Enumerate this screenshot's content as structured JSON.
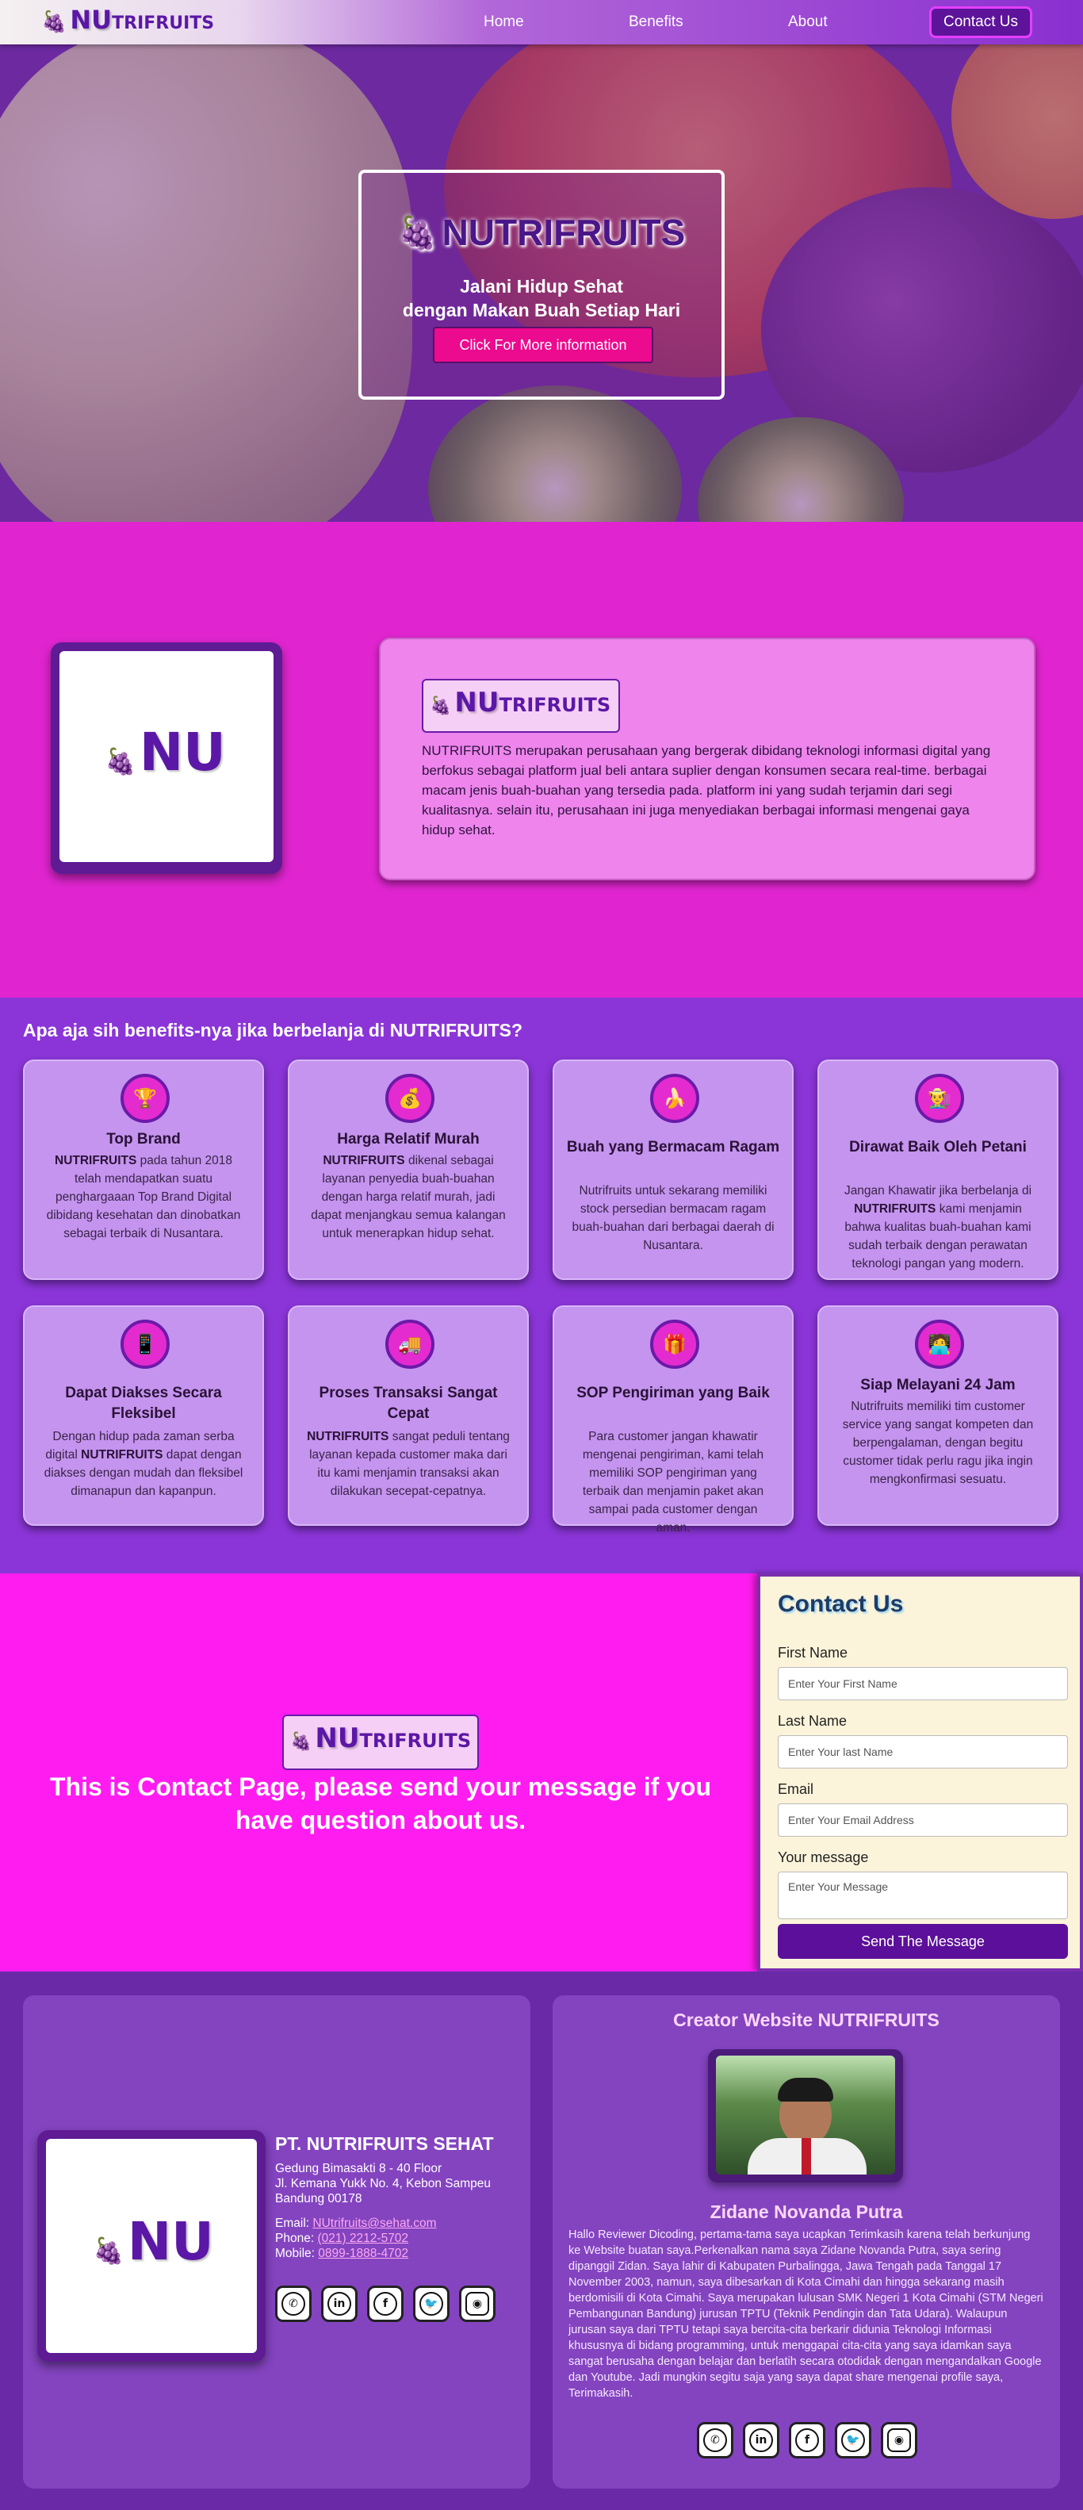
{
  "nav": {
    "logo_nu": "NU",
    "logo_rest": "TRIFRUITS",
    "links": [
      "Home",
      "Benefits",
      "About"
    ],
    "contact": "Contact Us"
  },
  "hero": {
    "title": "NUTRIFRUITS",
    "subtitle_line1": "Jalani Hidup Sehat",
    "subtitle_line2": "dengan Makan Buah Setiap Hari",
    "button": "Click For More information"
  },
  "about": {
    "logo_nu": "NU",
    "badge_nu": "NU",
    "badge_rest": "TRIFRUITS",
    "text": "NUTRIFRUITS merupakan perusahaan yang bergerak dibidang teknologi informasi digital yang berfokus sebagai platform jual beli antara suplier dengan konsumen secara real-time. berbagai macam jenis buah-buahan yang tersedia pada. platform ini yang sudah terjamin dari segi kualitasnya. selain itu, perusahaan ini juga menyediakan berbagai informasi mengenai gaya hidup sehat."
  },
  "benefits": {
    "heading": "Apa aja sih benefits-nya jika berbelanja di NUTRIFRUITS?",
    "cards": [
      {
        "icon": "trophy-icon",
        "glyph": "🏆",
        "title": "Top Brand",
        "bold": "NUTRIFRUITS",
        "desc": " pada tahun 2018 telah mendapatkan suatu penghargaaan Top Brand Digital dibidang kesehatan dan dinobatkan sebagai terbaik di Nusantara.",
        "tail": ""
      },
      {
        "icon": "money-bag-icon",
        "glyph": "💰",
        "title": "Harga Relatif Murah",
        "bold": "NUTRIFRUITS",
        "desc": " dikenal sebagai layanan penyedia buah-buahan dengan harga relatif murah, jadi dapat menjangkau semua kalangan untuk menerapkan hidup sehat.",
        "tail": ""
      },
      {
        "icon": "banana-icon",
        "glyph": "🍌",
        "title": "Buah yang Bermacam Ragam",
        "bold": "",
        "desc": "Nutrifruits untuk sekarang memiliki stock persedian bermacam ragam buah-buahan dari berbagai daerah di Nusantara.",
        "tail": ""
      },
      {
        "icon": "farmer-icon",
        "glyph": "👨‍🌾",
        "title": "Dirawat Baik Oleh Petani",
        "pre": "Jangan Khawatir jika berbelanja di ",
        "bold": "NUTRIFRUITS",
        "desc": " kami menjamin bahwa kualitas buah-buahan kami sudah terbaik dengan perawatan teknologi pangan yang modern.",
        "tail": ""
      },
      {
        "icon": "mobile-phone-icon",
        "glyph": "📱",
        "title": "Dapat Diakses Secara Fleksibel",
        "pre": "Dengan hidup pada zaman serba digital ",
        "bold": "NUTRIFRUITS",
        "desc": " dapat dengan diakses dengan mudah dan fleksibel dimanapun dan kapanpun.",
        "tail": ""
      },
      {
        "icon": "delivery-truck-icon",
        "glyph": "🚚",
        "title": "Proses Transaksi Sangat Cepat",
        "bold": "NUTRIFRUITS",
        "desc": " sangat peduli tentang layanan kepada customer maka dari itu kami menjamin transaksi akan dilakukan secepat-cepatnya.",
        "tail": ""
      },
      {
        "icon": "gift-icon",
        "glyph": "🎁",
        "title": "SOP Pengiriman yang Baik",
        "bold": "",
        "desc": "Para customer jangan khawatir mengenai pengiriman, kami telah memiliki SOP pengiriman yang terbaik dan menjamin paket akan sampai pada customer dengan aman.",
        "tail": ""
      },
      {
        "icon": "support-agent-icon",
        "glyph": "🧑‍💻",
        "title": "Siap Melayani 24 Jam",
        "bold": "",
        "desc": "Nutrifruits memiliki tim customer service yang sangat kompeten dan berpengalaman, dengan begitu customer tidak perlu ragu jika ingin mengkonfirmasi sesuatu.",
        "tail": ""
      }
    ]
  },
  "contact": {
    "badge_nu": "NU",
    "badge_rest": "TRIFRUITS",
    "message": "This is Contact Page, please send your message if you have question about us.",
    "form": {
      "title": "Contact Us",
      "first_label": "First Name",
      "first_placeholder": "Enter Your First Name",
      "last_label": "Last Name",
      "last_placeholder": "Enter Your last Name",
      "email_label": "Email",
      "email_placeholder": "Enter Your Email Address",
      "msg_label": "Your message",
      "msg_placeholder": "Enter Your Message",
      "submit": "Send The Message"
    }
  },
  "footer": {
    "logo_nu": "NU",
    "company_name": "PT. NUTRIFRUITS SEHAT",
    "address_1": "Gedung Bimasakti 8 - 40 Floor",
    "address_2": "Jl. Kemana Yukk No. 4, Kebon Sampeu",
    "address_3": "Bandung 00178",
    "email_label": "Email: ",
    "email": "NUtrifruits@sehat.com",
    "phone_label": "Phone: ",
    "phone": "(021) 2212-5702",
    "mobile_label": "Mobile: ",
    "mobile": "0899-1888-4702",
    "creator_title": "Creator Website NUTRIFRUITS",
    "creator_name": "Zidane Novanda Putra",
    "creator_bio": "Hallo Reviewer Dicoding, pertama-tama saya ucapkan Terimkasih karena telah berkunjung ke Website buatan saya.Perkenalkan nama saya Zidane Novanda Putra, saya sering dipanggil Zidan. Saya lahir di Kabupaten Purbalingga, Jawa Tengah pada Tanggal 17 November 2003, namun, saya dibesarkan di Kota Cimahi dan hingga sekarang masih berdomisili di Kota Cimahi. Saya merupakan lulusan SMK Negeri 1 Kota Cimahi (STM Negeri Pembangunan Bandung) jurusan TPTU (Teknik Pendingin dan Tata Udara). Walaupun jurusan saya dari TPTU tetapi saya bercita-cita berkarir didunia Teknologi Informasi khususnya di bidang programming, untuk menggapai cita-cita yang saya idamkan saya sangat berusaha dengan belajar dan berlatih secara otodidak dengan mengandalkan Google dan Youtube. Jadi mungkin segitu saja yang saya dapat share mengenai profile saya, Terimakasih.",
    "socials": [
      "whatsapp-icon",
      "linkedin-icon",
      "facebook-icon",
      "twitter-icon",
      "instagram-icon"
    ]
  },
  "colors": {
    "brand_purple": "#5b17a6",
    "accent_pink": "#ec0a8e",
    "about_bg": "#e025d0",
    "benefits_bg": "#8b35d8",
    "contact_bg": "#ff1cf0",
    "footer_bg": "#6a2aa8"
  }
}
